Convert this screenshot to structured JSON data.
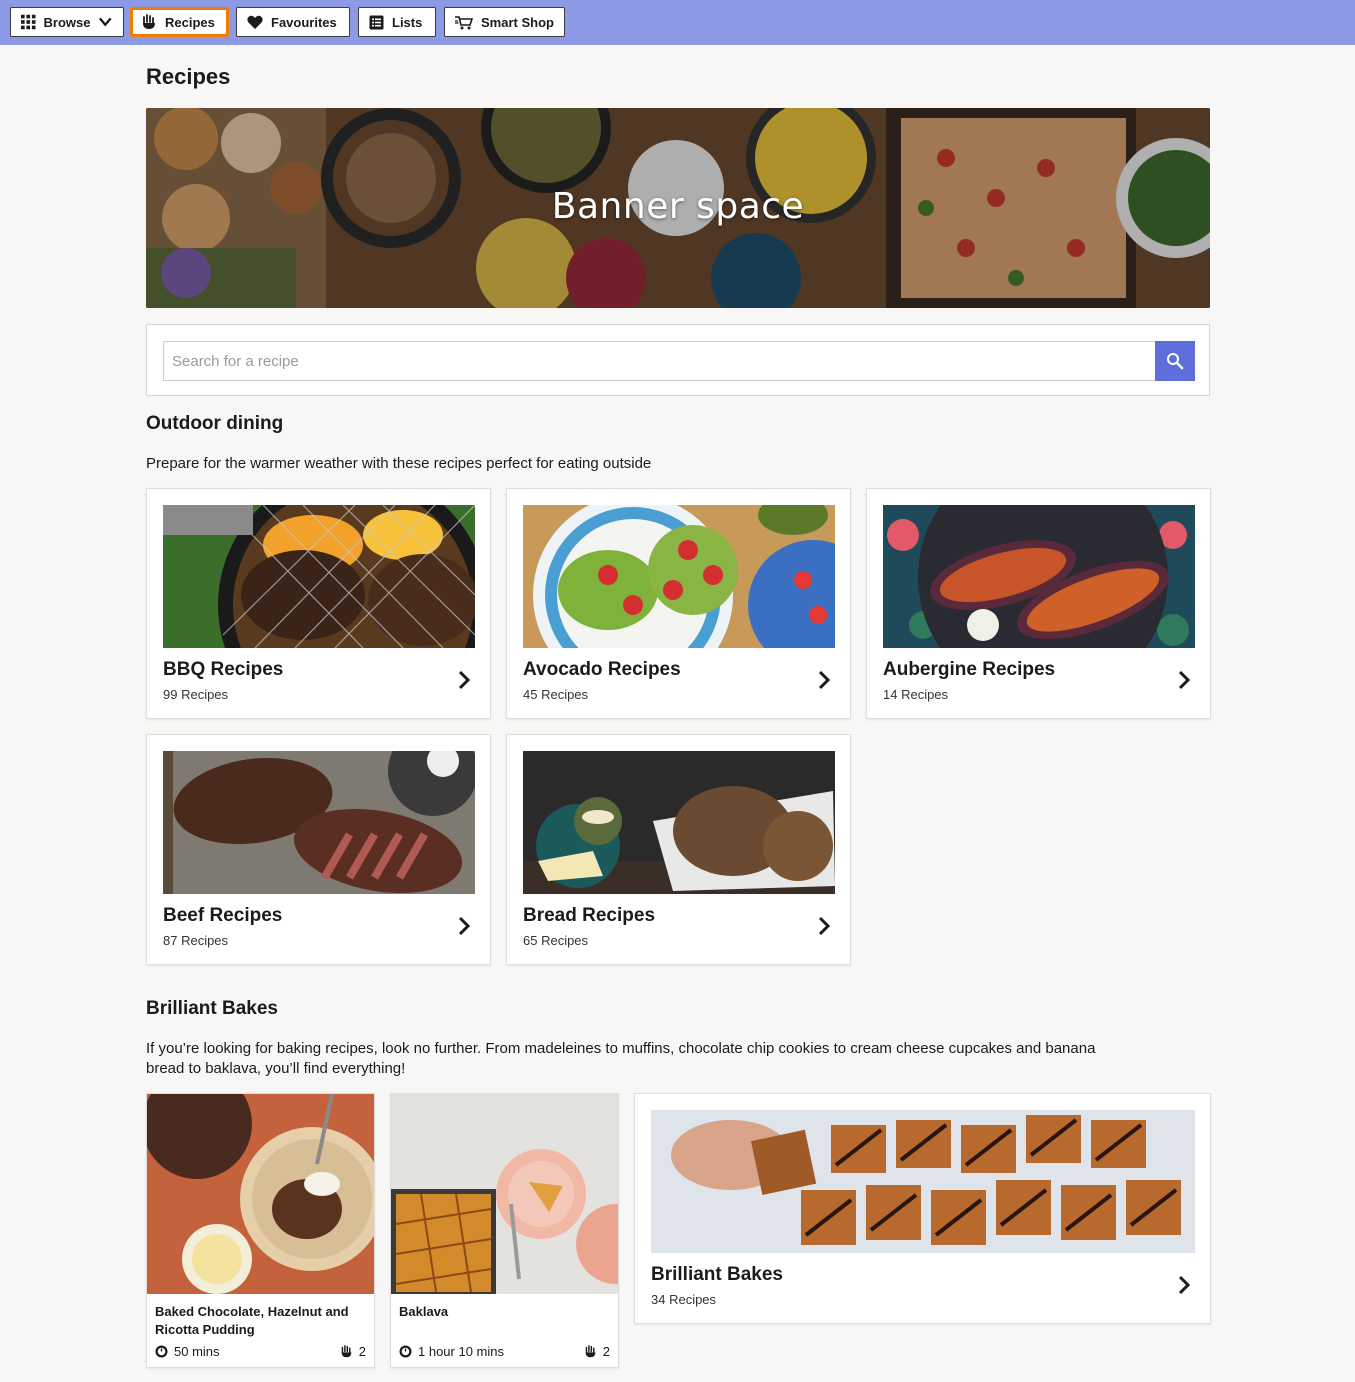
{
  "nav": {
    "items": [
      {
        "label": "Browse",
        "icon": "grid-icon"
      },
      {
        "label": "Recipes",
        "icon": "chef-hand-icon",
        "active": true
      },
      {
        "label": "Favourites",
        "icon": "heart-icon"
      },
      {
        "label": "Lists",
        "icon": "list-icon"
      },
      {
        "label": "Smart Shop",
        "icon": "cart-icon"
      }
    ]
  },
  "page": {
    "title": "Recipes"
  },
  "banner": {
    "text": "Banner space"
  },
  "search": {
    "placeholder": "Search for a recipe",
    "value": ""
  },
  "outdoor": {
    "title": "Outdoor dining",
    "description": "Prepare for the warmer weather with these recipes perfect for eating outside",
    "cards": [
      {
        "title": "BBQ Recipes",
        "count": "99 Recipes"
      },
      {
        "title": "Avocado Recipes",
        "count": "45 Recipes"
      },
      {
        "title": "Aubergine Recipes",
        "count": "14 Recipes"
      },
      {
        "title": "Beef Recipes",
        "count": "87 Recipes"
      },
      {
        "title": "Bread Recipes",
        "count": "65 Recipes"
      }
    ]
  },
  "bakes": {
    "title": "Brilliant Bakes",
    "description_line1": "If you’re looking for baking recipes, look no further. From madeleines to muffins, chocolate chip cookies to cream cheese cupcakes and banana",
    "description_line2": "bread to baklava, you’ll find everything!",
    "recipes": [
      {
        "title": "Baked Chocolate, Hazelnut and Ricotta Pudding",
        "time": "50 mins",
        "serves": "2"
      },
      {
        "title": "Baklava",
        "time": "1 hour 10 mins",
        "serves": "2"
      }
    ],
    "collection": {
      "title": "Brilliant Bakes",
      "count": "34 Recipes"
    }
  },
  "colors": {
    "nav_bg": "#8c9ae6",
    "active_border": "#f07c00",
    "search_button": "#5e6fdb"
  }
}
